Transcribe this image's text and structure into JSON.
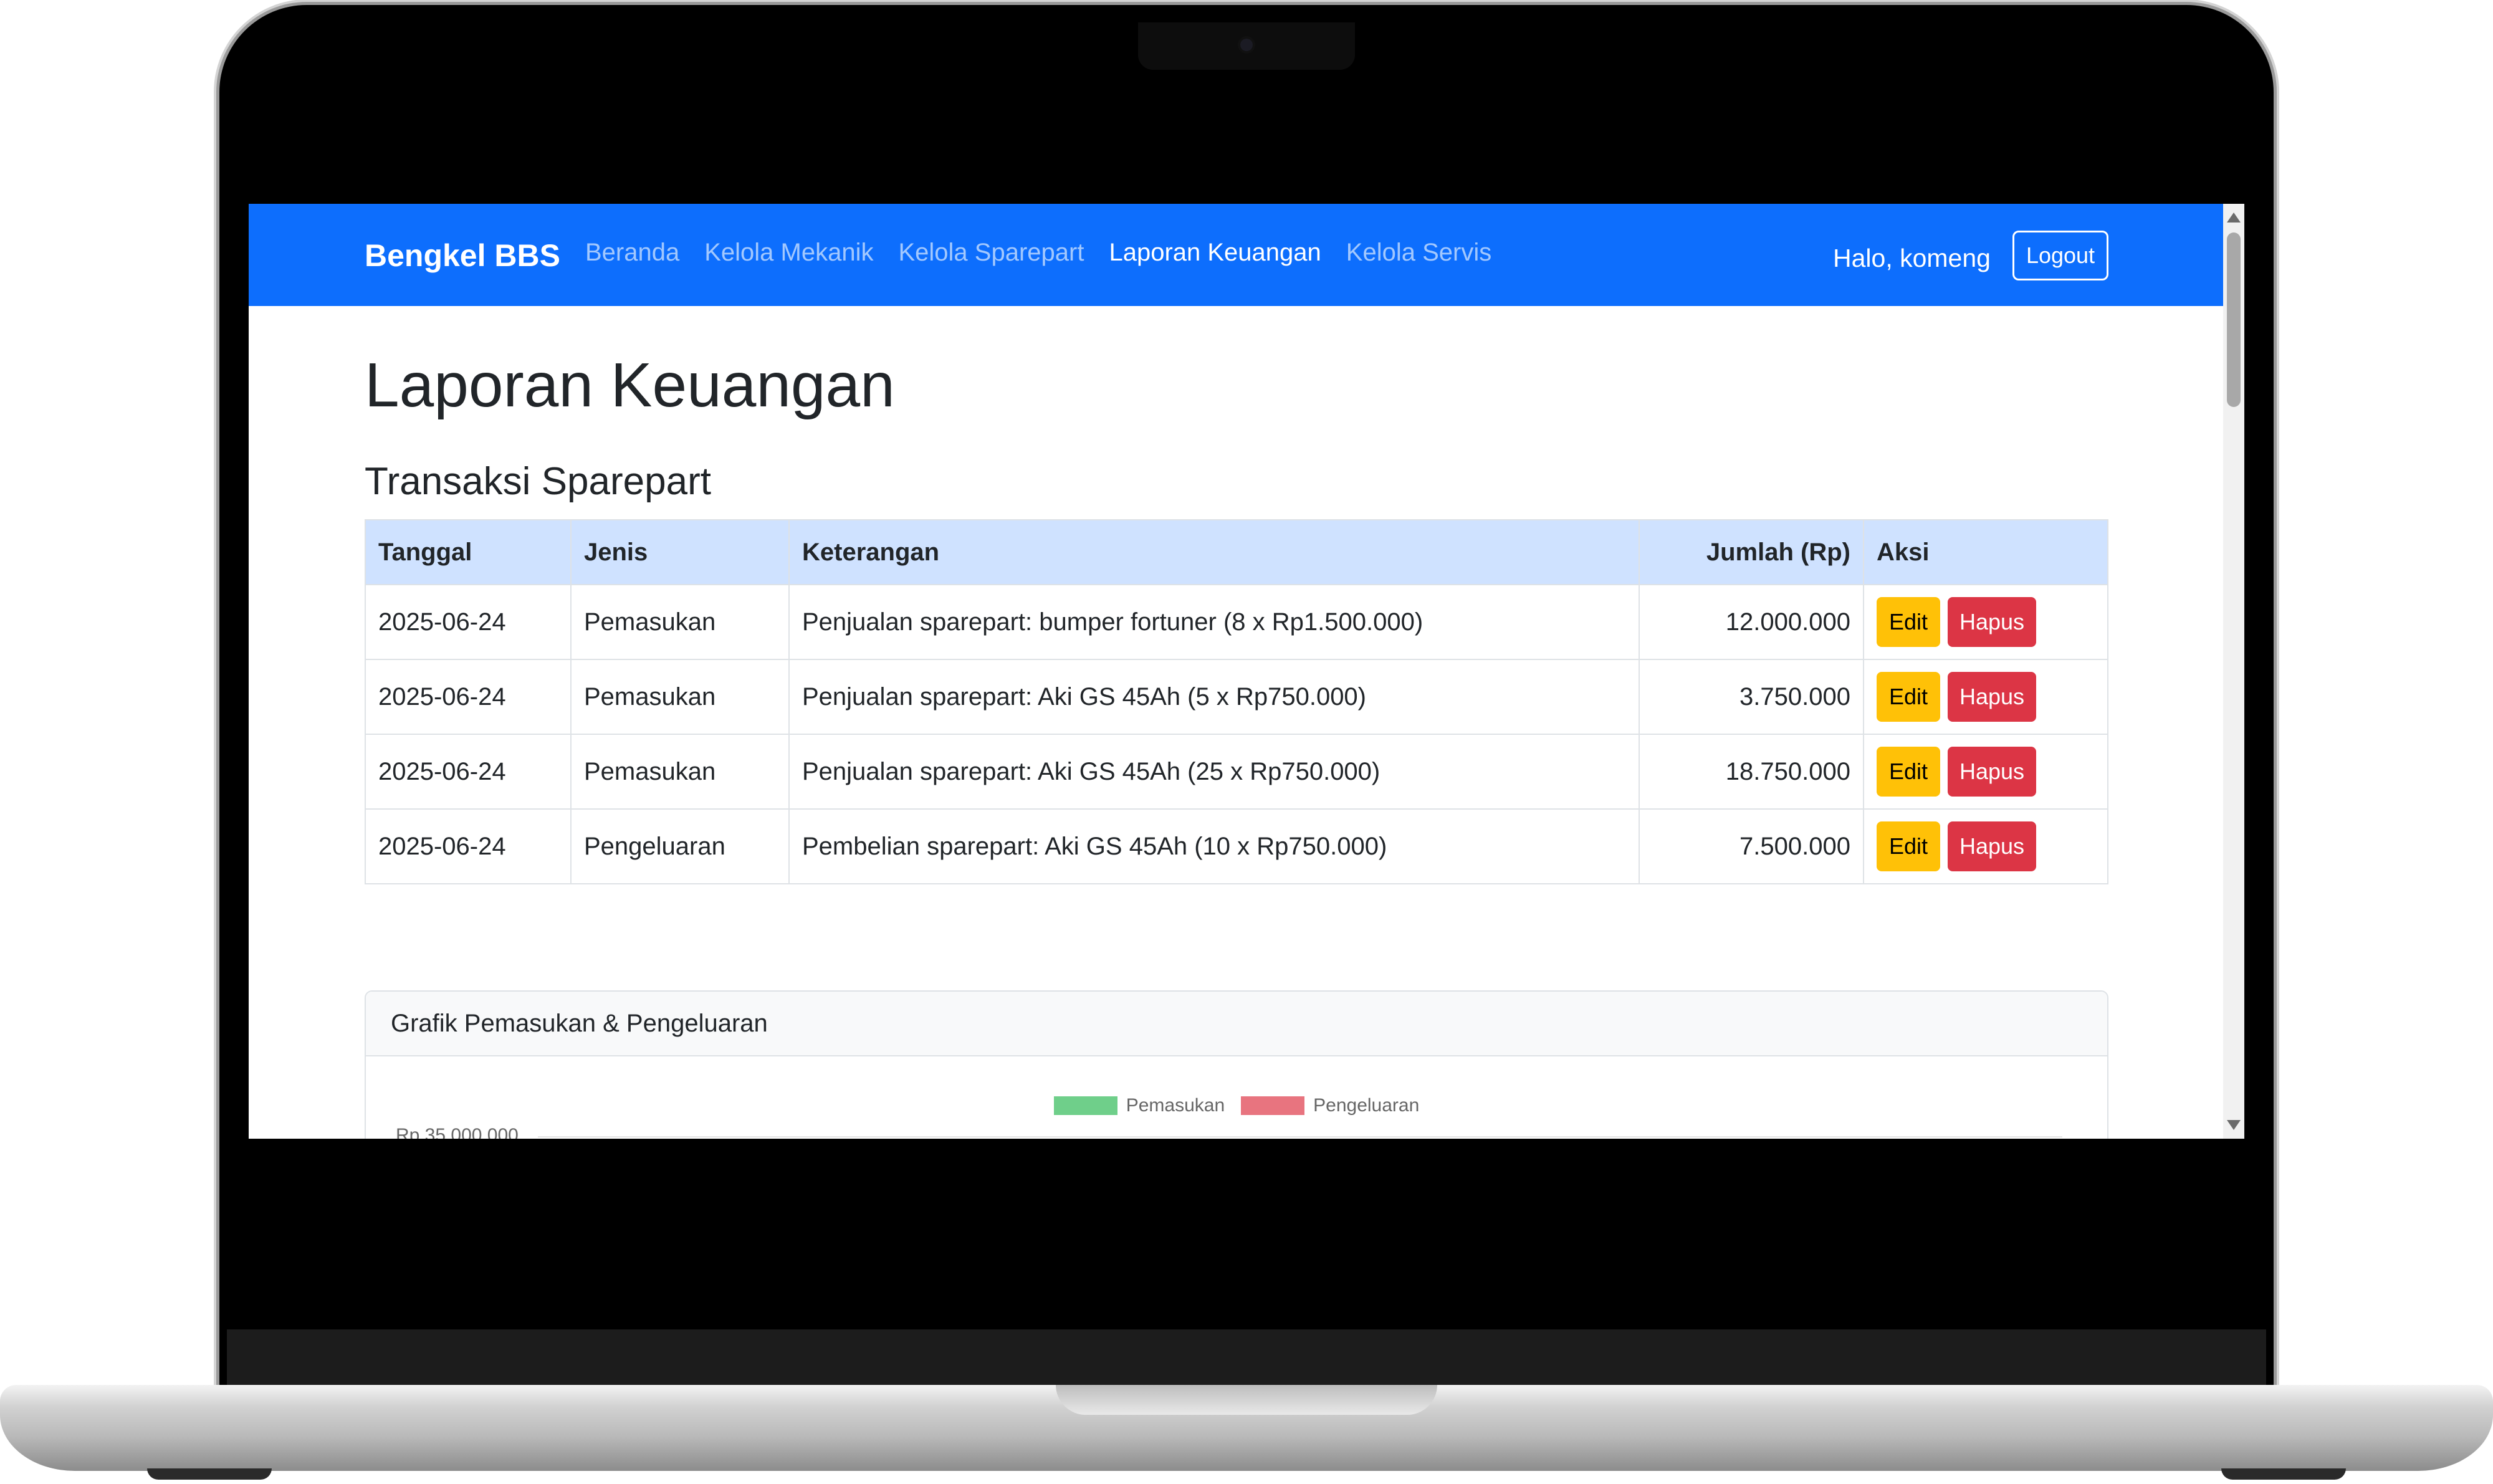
{
  "navbar": {
    "brand": "Bengkel BBS",
    "links": [
      {
        "label": "Beranda",
        "active": false
      },
      {
        "label": "Kelola Mekanik",
        "active": false
      },
      {
        "label": "Kelola Sparepart",
        "active": false
      },
      {
        "label": "Laporan Keuangan",
        "active": true
      },
      {
        "label": "Kelola Servis",
        "active": false
      }
    ],
    "greeting": "Halo, komeng",
    "logout_label": "Logout"
  },
  "page": {
    "title": "Laporan Keuangan",
    "section_title": "Transaksi Sparepart"
  },
  "table": {
    "headers": [
      "Tanggal",
      "Jenis",
      "Keterangan",
      "Jumlah (Rp)",
      "Aksi"
    ],
    "rows": [
      {
        "tanggal": "2025-06-24",
        "jenis": "Pemasukan",
        "keterangan": "Penjualan sparepart: bumper fortuner (8 x Rp1.500.000)",
        "jumlah": "12.000.000"
      },
      {
        "tanggal": "2025-06-24",
        "jenis": "Pemasukan",
        "keterangan": "Penjualan sparepart: Aki GS 45Ah (5 x Rp750.000)",
        "jumlah": "3.750.000"
      },
      {
        "tanggal": "2025-06-24",
        "jenis": "Pemasukan",
        "keterangan": "Penjualan sparepart: Aki GS 45Ah (25 x Rp750.000)",
        "jumlah": "18.750.000"
      },
      {
        "tanggal": "2025-06-24",
        "jenis": "Pengeluaran",
        "keterangan": "Pembelian sparepart: Aki GS 45Ah (10 x Rp750.000)",
        "jumlah": "7.500.000"
      }
    ],
    "edit_label": "Edit",
    "delete_label": "Hapus"
  },
  "chart_card": {
    "title": "Grafik Pemasukan & Pengeluaran"
  },
  "chart_data": {
    "type": "bar",
    "title": "",
    "series": [
      {
        "name": "Pemasukan",
        "color": "#6fcf8a"
      },
      {
        "name": "Pengeluaran",
        "color": "#e8747f"
      }
    ],
    "y_ticks": [
      "Rp 35.000.000"
    ]
  },
  "colors": {
    "primary": "#0d6efd",
    "table_header": "#cfe2ff",
    "warning": "#ffc107",
    "danger": "#dc3545"
  }
}
